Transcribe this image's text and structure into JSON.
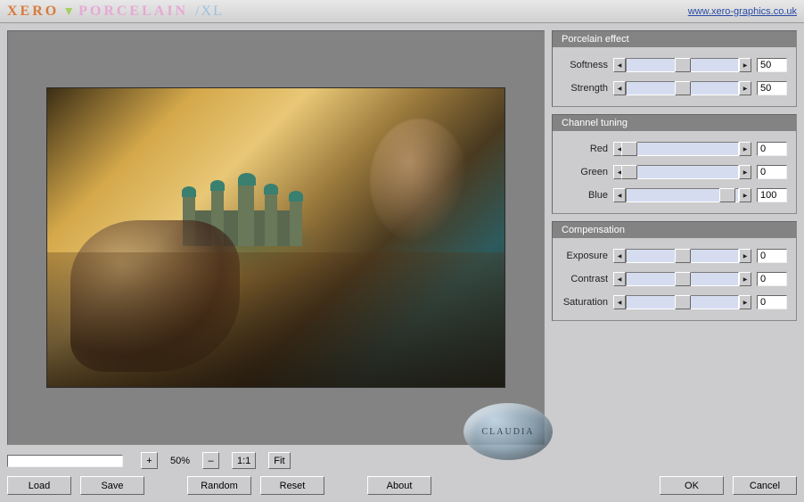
{
  "title": {
    "brand": "XERO",
    "product": "PORCELAIN",
    "suffix": "/XL"
  },
  "url": "www.xero-graphics.co.uk",
  "watermark": "CLAUDIA",
  "groups": {
    "porcelain": {
      "header": "Porcelain effect",
      "softness": {
        "label": "Softness",
        "value": "50",
        "pos": 50
      },
      "strength": {
        "label": "Strength",
        "value": "50",
        "pos": 50
      }
    },
    "channel": {
      "header": "Channel tuning",
      "red": {
        "label": "Red",
        "value": "0",
        "pos": 2
      },
      "green": {
        "label": "Green",
        "value": "0",
        "pos": 2
      },
      "blue": {
        "label": "Blue",
        "value": "100",
        "pos": 90
      }
    },
    "compensation": {
      "header": "Compensation",
      "exposure": {
        "label": "Exposure",
        "value": "0",
        "pos": 50
      },
      "contrast": {
        "label": "Contrast",
        "value": "0",
        "pos": 50
      },
      "saturation": {
        "label": "Saturation",
        "value": "0",
        "pos": 50
      }
    }
  },
  "zoom": {
    "plus": "+",
    "minus": "–",
    "value": "50%",
    "one": "1:1",
    "fit": "Fit"
  },
  "buttons": {
    "load": "Load",
    "save": "Save",
    "random": "Random",
    "reset": "Reset",
    "about": "About",
    "ok": "OK",
    "cancel": "Cancel"
  }
}
